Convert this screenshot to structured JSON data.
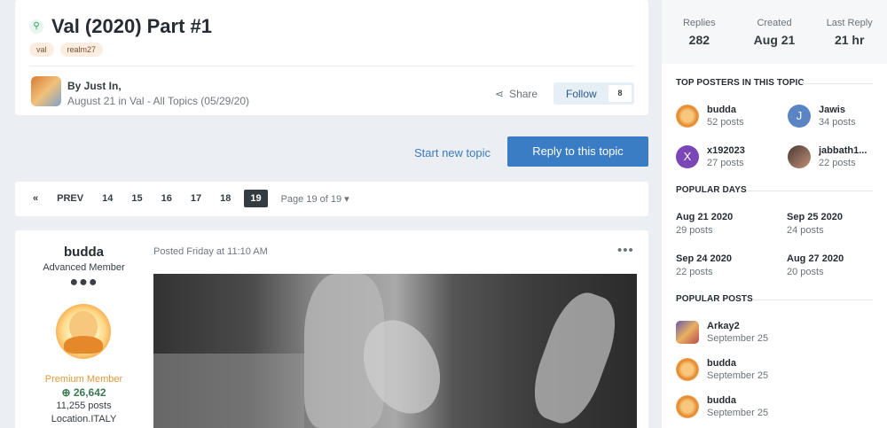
{
  "topic": {
    "pin_icon": "pin-icon",
    "title": "Val (2020) Part #1",
    "tags": [
      "val",
      "realm27"
    ],
    "byline": "By Just In,",
    "byline_sub": "August 21 in Val - All Topics (05/29/20)",
    "share_label": "Share",
    "follow_label": "Follow",
    "follow_count": "8"
  },
  "actions": {
    "start_new_topic": "Start new topic",
    "reply": "Reply to this topic"
  },
  "pagination": {
    "prev_icon": "double-chevron-left-icon",
    "prev_label": "PREV",
    "pages": [
      "14",
      "15",
      "16",
      "17",
      "18",
      "19"
    ],
    "current_page": "19",
    "page_info": "Page 19 of 19",
    "dropdown_icon": "caret-down-icon"
  },
  "post": {
    "author": "budda",
    "rank": "Advanced Member",
    "rank_dots": "●●●",
    "premium": "Premium Member",
    "reputation": "26,642",
    "post_count": "11,255 posts",
    "location": "Location.ITALY",
    "posted": "Posted Friday at 11:10 AM",
    "menu": "•••"
  },
  "sidebar": {
    "stats": [
      {
        "label": "Replies",
        "value": "282"
      },
      {
        "label": "Created",
        "value": "Aug 21"
      },
      {
        "label": "Last Reply",
        "value": "21 hr"
      }
    ],
    "top_posters_title": "TOP POSTERS IN THIS TOPIC",
    "top_posters": [
      {
        "name": "budda",
        "posts": "52 posts",
        "initial": ""
      },
      {
        "name": "Jawis",
        "posts": "34 posts",
        "initial": "J"
      },
      {
        "name": "x192023",
        "posts": "27 posts",
        "initial": "X"
      },
      {
        "name": "jabbath1...",
        "posts": "22 posts",
        "initial": ""
      }
    ],
    "popular_days_title": "POPULAR DAYS",
    "popular_days": [
      {
        "date": "Aug 21 2020",
        "posts": "29 posts"
      },
      {
        "date": "Sep 25 2020",
        "posts": "24 posts"
      },
      {
        "date": "Sep 24 2020",
        "posts": "22 posts"
      },
      {
        "date": "Aug 27 2020",
        "posts": "20 posts"
      }
    ],
    "popular_posts_title": "POPULAR POSTS",
    "popular_posts": [
      {
        "name": "Arkay2",
        "date": "September 25"
      },
      {
        "name": "budda",
        "date": "September 25"
      },
      {
        "name": "budda",
        "date": "September 25"
      }
    ]
  }
}
